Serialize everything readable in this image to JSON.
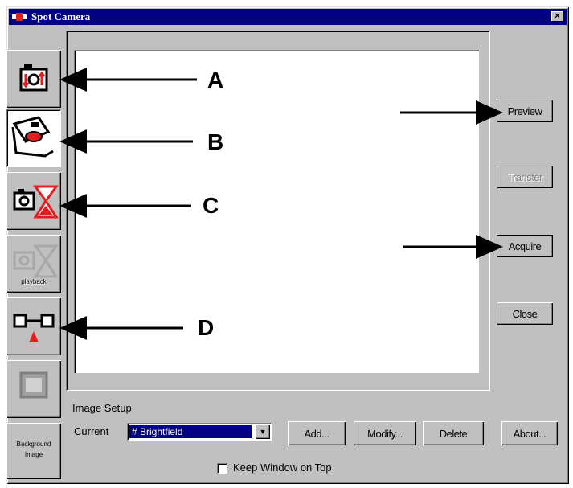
{
  "window": {
    "title": "Spot Camera",
    "close_glyph": "×"
  },
  "toolbar": [
    {
      "name": "exposure-tool",
      "icon": "camera-exposure-icon"
    },
    {
      "name": "video-tool",
      "icon": "video-camera-icon"
    },
    {
      "name": "timelapse-tool",
      "icon": "camera-hourglass-icon"
    },
    {
      "name": "timelapse-playback-tool",
      "icon": "camera-hourglass-disabled-icon",
      "label": "playback"
    },
    {
      "name": "selection-tool",
      "icon": "selection-marker-icon"
    },
    {
      "name": "blank-tool",
      "icon": "monitor-icon"
    },
    {
      "name": "background-image-tool",
      "label": "Background Image"
    }
  ],
  "side_buttons": {
    "preview": "Preview",
    "transfer": "Transfer",
    "acquire": "Acquire",
    "close": "Close"
  },
  "image_setup": {
    "group_label": "Image Setup",
    "current_label": "Current",
    "current_value": "# Brightfield",
    "add": "Add...",
    "modify": "Modify...",
    "delete": "Delete"
  },
  "about": "About...",
  "keep_on_top": {
    "label": "Keep Window on Top",
    "checked": false
  },
  "annotations": [
    "A",
    "B",
    "C",
    "D"
  ],
  "colors": {
    "title_bg": "#000080",
    "face": "#c0c0c0",
    "accent_red": "#e02020"
  }
}
